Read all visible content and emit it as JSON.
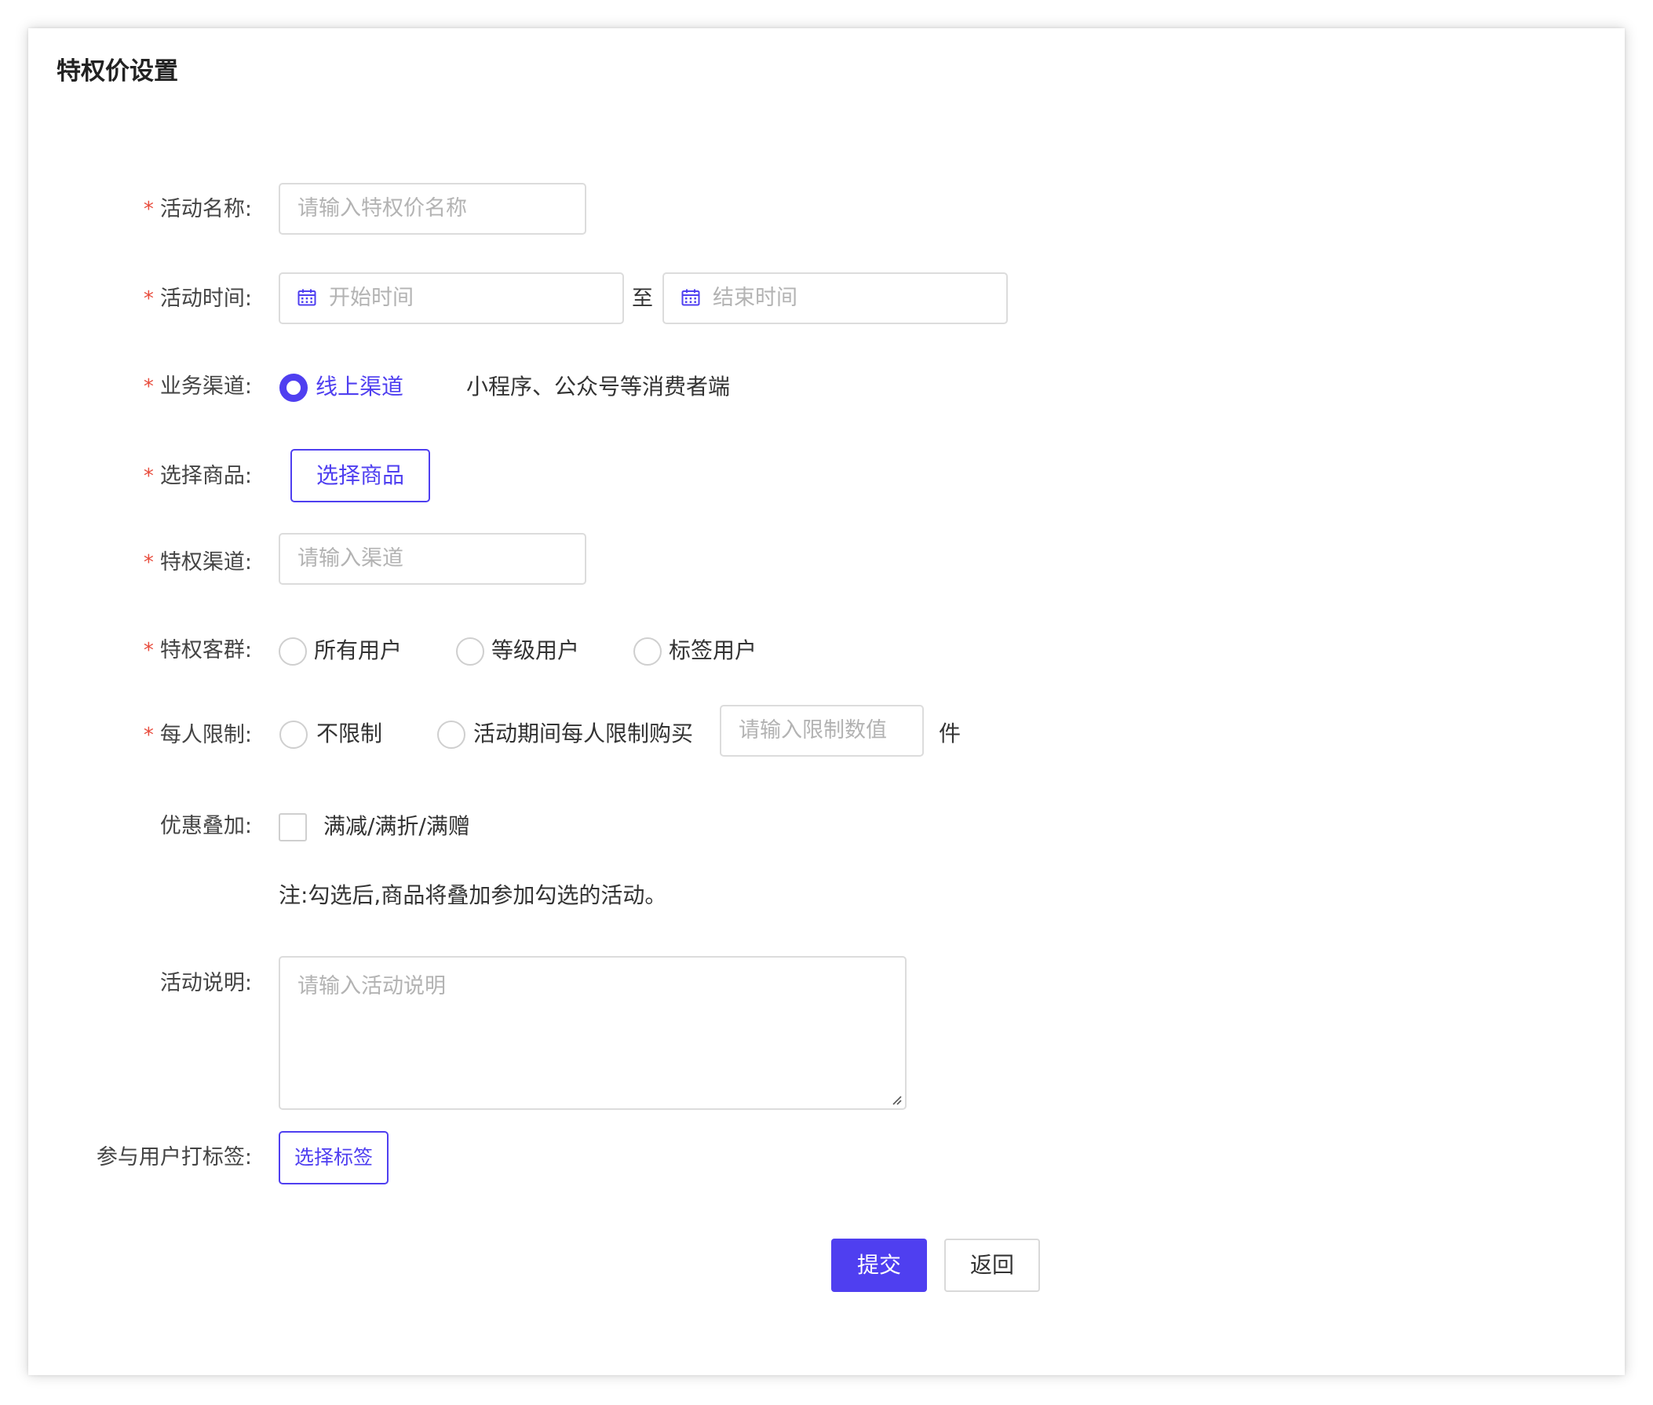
{
  "page": {
    "title": "特权价设置"
  },
  "required_mark": "*",
  "form": {
    "activity_name": {
      "label": "活动名称:",
      "placeholder": "请输入特权价名称"
    },
    "activity_time": {
      "label": "活动时间:",
      "start_placeholder": "开始时间",
      "separator": "至",
      "end_placeholder": "结束时间",
      "icon": "calendar-icon"
    },
    "business_channel": {
      "label": "业务渠道:",
      "option": "线上渠道",
      "selected": true,
      "description": "小程序、公众号等消费者端"
    },
    "select_product": {
      "label": "选择商品:",
      "button": "选择商品"
    },
    "privilege_channel": {
      "label": "特权渠道:",
      "placeholder": "请输入渠道"
    },
    "privilege_group": {
      "label": "特权客群:",
      "options": [
        "所有用户",
        "等级用户",
        "标签用户"
      ]
    },
    "per_person_limit": {
      "label": "每人限制:",
      "options": [
        "不限制",
        "活动期间每人限制购买"
      ],
      "placeholder": "请输入限制数值",
      "unit": "件"
    },
    "discount_stack": {
      "label": "优惠叠加:",
      "checkbox_label": "满减/满折/满赠",
      "checked": false,
      "note": "注:勾选后,商品将叠加参加勾选的活动。"
    },
    "activity_desc": {
      "label": "活动说明:",
      "placeholder": "请输入活动说明"
    },
    "user_tag": {
      "label": "参与用户打标签:",
      "button": "选择标签"
    }
  },
  "actions": {
    "submit": "提交",
    "back": "返回"
  },
  "colors": {
    "primary": "#4f3ff0",
    "required": "#e84c3d",
    "placeholder": "#b3b3b3",
    "border": "#dcdcdc"
  }
}
